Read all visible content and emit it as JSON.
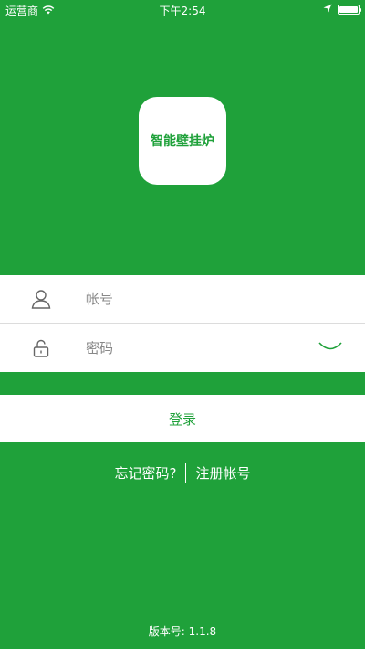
{
  "status_bar": {
    "carrier": "运营商",
    "time": "下午2:54"
  },
  "logo": {
    "text": "智能壁挂炉"
  },
  "form": {
    "account_placeholder": "帐号",
    "password_placeholder": "密码"
  },
  "login": {
    "label": "登录"
  },
  "links": {
    "forgot_password": "忘记密码?",
    "register": "注册帐号"
  },
  "footer": {
    "version": "版本号: 1.1.8"
  },
  "colors": {
    "brand": "#1fa13a",
    "background": "#1fa13a",
    "panel": "#ffffff",
    "icon": "#666666"
  },
  "icons": {
    "wifi": "wifi-icon",
    "location": "location-arrow-icon",
    "battery": "battery-icon",
    "user": "user-icon",
    "lock": "unlock-icon",
    "eye": "eye-closed-icon"
  }
}
